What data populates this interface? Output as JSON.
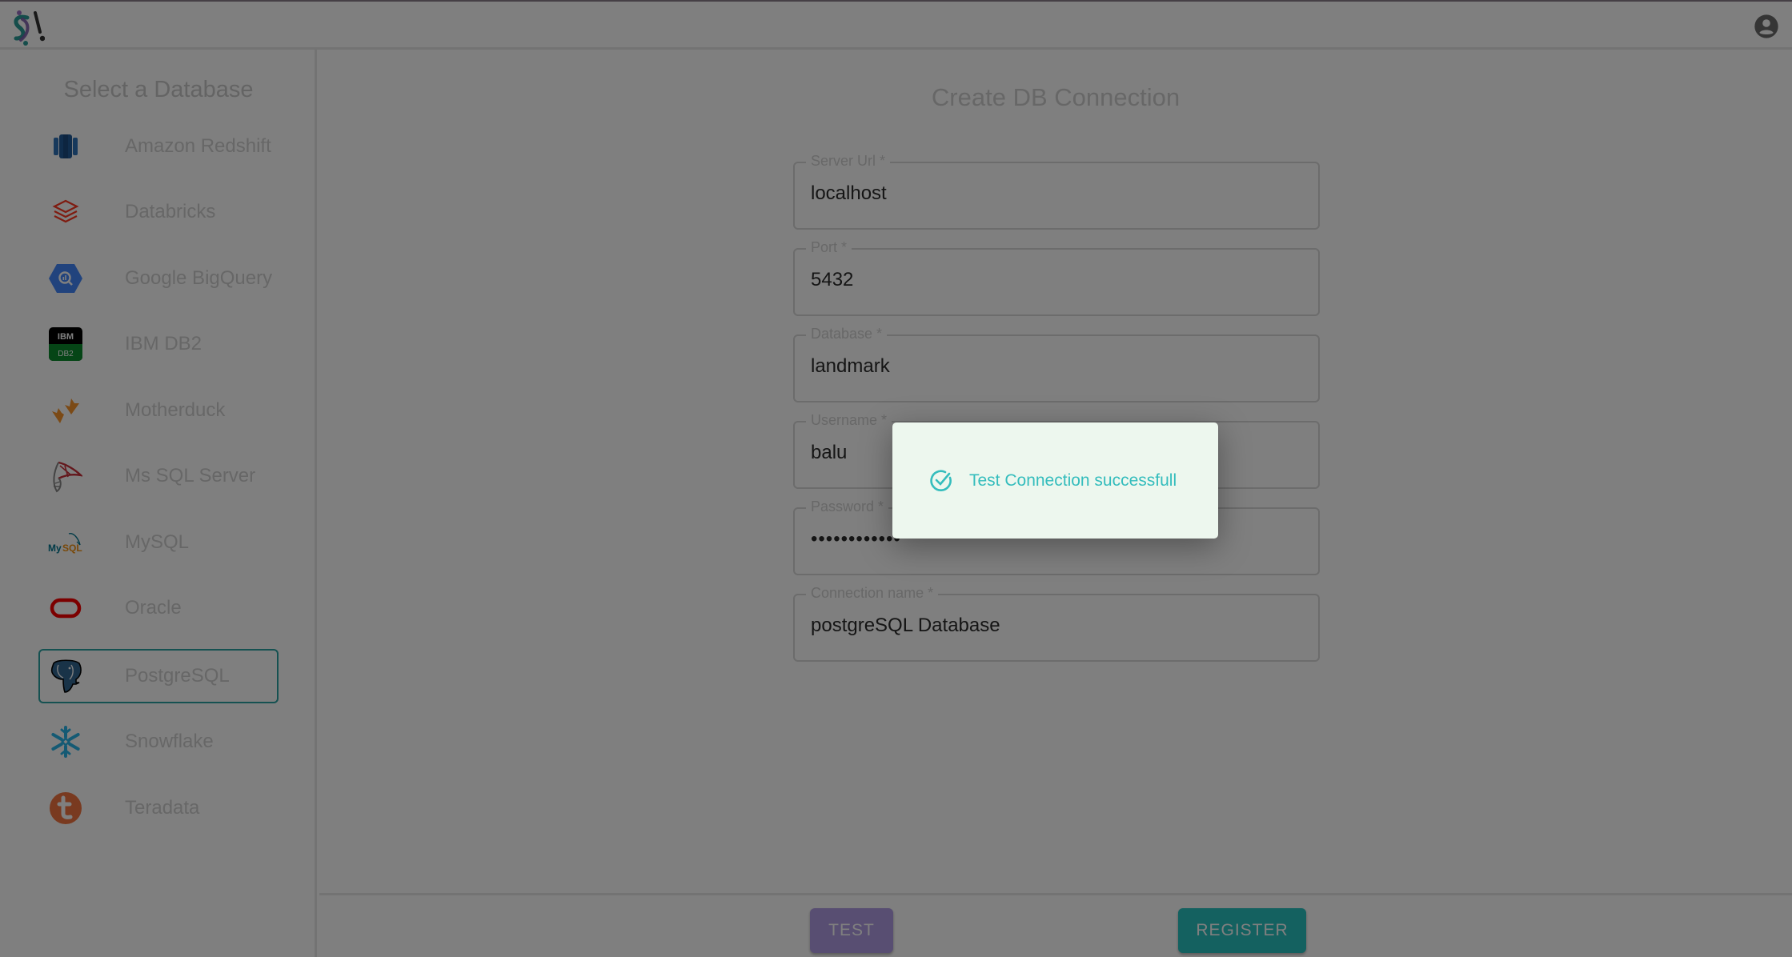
{
  "header": {
    "logo_icon": "logo-icon",
    "account_icon": "account-circle-icon"
  },
  "sidebar": {
    "title": "Select a Database",
    "items": [
      {
        "label": "Amazon Redshift",
        "icon": "amazon-redshift-icon",
        "selected": false
      },
      {
        "label": "Databricks",
        "icon": "databricks-icon",
        "selected": false
      },
      {
        "label": "Google BigQuery",
        "icon": "google-bigquery-icon",
        "selected": false
      },
      {
        "label": "IBM DB2",
        "icon": "ibm-db2-icon",
        "selected": false
      },
      {
        "label": "Motherduck",
        "icon": "motherduck-icon",
        "selected": false
      },
      {
        "label": "Ms SQL Server",
        "icon": "ms-sql-server-icon",
        "selected": false
      },
      {
        "label": "MySQL",
        "icon": "mysql-icon",
        "selected": false
      },
      {
        "label": "Oracle",
        "icon": "oracle-icon",
        "selected": false
      },
      {
        "label": "PostgreSQL",
        "icon": "postgresql-icon",
        "selected": true
      },
      {
        "label": "Snowflake",
        "icon": "snowflake-icon",
        "selected": false
      },
      {
        "label": "Teradata",
        "icon": "teradata-icon",
        "selected": false
      }
    ]
  },
  "form": {
    "title": "Create DB Connection",
    "fields": [
      {
        "label": "Server Url *",
        "value": "localhost"
      },
      {
        "label": "Port *",
        "value": "5432"
      },
      {
        "label": "Database *",
        "value": "landmark"
      },
      {
        "label": "Username *",
        "value": "balu"
      },
      {
        "label": "Password *",
        "value": "••••••••••••"
      },
      {
        "label": "Connection name *",
        "value": "postgreSQL Database"
      }
    ]
  },
  "footer": {
    "test_label": "TEST",
    "register_label": "REGISTER"
  },
  "dialog": {
    "icon": "check-circle-icon",
    "message": "Test Connection successfull"
  },
  "colors": {
    "accent_teal": "#28c2c0",
    "accent_purple": "#b09ce4",
    "success_text": "#35bdbd",
    "dialog_bg": "#edf7ee"
  }
}
